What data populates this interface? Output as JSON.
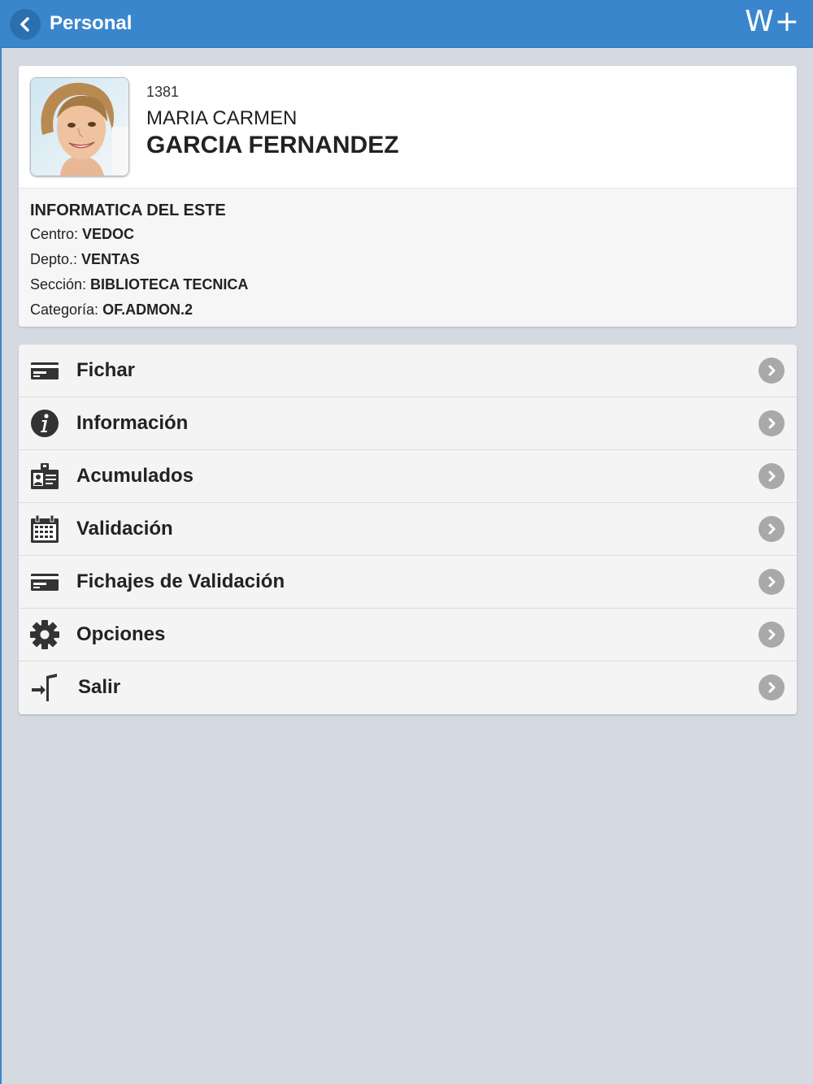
{
  "header": {
    "title": "Personal",
    "back_icon": "chevron-left-icon",
    "brand": "W+"
  },
  "profile": {
    "employee_id": "1381",
    "first_name": "MARIA CARMEN",
    "last_name": "GARCIA FERNANDEZ",
    "company": "INFORMATICA DEL ESTE",
    "details": [
      {
        "label": "Centro: ",
        "value": "VEDOC"
      },
      {
        "label": "Depto.: ",
        "value": "VENTAS"
      },
      {
        "label": "Sección: ",
        "value": "BIBLIOTECA TECNICA"
      },
      {
        "label": "Categoría: ",
        "value": "OF.ADMON.2"
      }
    ]
  },
  "menu": {
    "items": [
      {
        "label": "Fichar",
        "icon": "card-icon"
      },
      {
        "label": "Información",
        "icon": "info-icon"
      },
      {
        "label": "Acumulados",
        "icon": "id-badge-icon"
      },
      {
        "label": "Validación",
        "icon": "calendar-icon"
      },
      {
        "label": "Fichajes de Validación",
        "icon": "card-icon"
      },
      {
        "label": "Opciones",
        "icon": "gear-icon"
      },
      {
        "label": "Salir",
        "icon": "exit-icon"
      }
    ]
  },
  "colors": {
    "header": "#3a86cc",
    "background": "#d5d9e1",
    "chevron": "#a9a9a9"
  }
}
